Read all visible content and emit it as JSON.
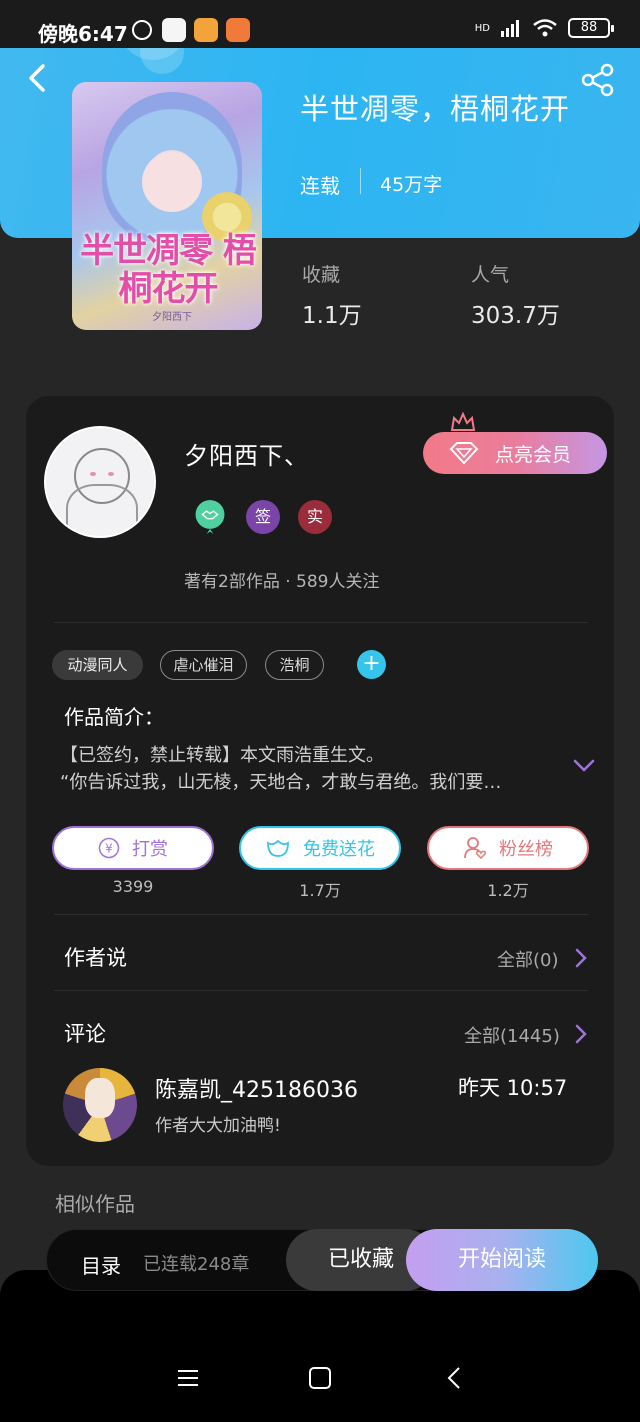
{
  "status_bar": {
    "time": "傍晚6:47",
    "network": "HD",
    "battery": "88"
  },
  "book": {
    "title": "半世凋零，梧桐花开",
    "status": "连载",
    "word_count": "45万字",
    "cover_title": "半世凋零 梧桐花开",
    "cover_author": "夕阳西下"
  },
  "stats": {
    "favorites_label": "收藏",
    "favorites_value": "1.1万",
    "popularity_label": "人气",
    "popularity_value": "303.7万"
  },
  "author": {
    "name": "夕阳西下、",
    "badges": [
      "签",
      "实"
    ],
    "meta": "著有2部作品 · 589人关注",
    "vip_button": "点亮会员"
  },
  "tags": [
    "动漫同人",
    "虐心催泪",
    "浩桐"
  ],
  "intro": {
    "title": "作品简介：",
    "line1": "【已签约，禁止转载】本文雨浩重生文。",
    "line2": "“你告诉过我，山无棱，天地合，才敢与君绝。我们要…"
  },
  "actions": [
    {
      "label": "打赏",
      "count": "3399"
    },
    {
      "label": "免费送花",
      "count": "1.7万"
    },
    {
      "label": "粉丝榜",
      "count": "1.2万"
    }
  ],
  "author_says": {
    "title": "作者说",
    "link": "全部(0)"
  },
  "comments": {
    "title": "评论",
    "link": "全部(1445)",
    "items": [
      {
        "user": "陈嘉凯_425186036",
        "time": "昨天 10:57",
        "text": "作者大大加油鸭!"
      }
    ]
  },
  "similar_title": "相似作品",
  "bottom_bar": {
    "toc": "目录",
    "chapters": "已连载248章",
    "collected": "已收藏",
    "read": "开始阅读"
  },
  "colors": {
    "header": "#2cb5f2",
    "accent_cyan": "#35c4ea",
    "vip_start": "#f27a88",
    "vip_end": "#c596e4",
    "reward_purple": "#a073dc",
    "flower_cyan": "#35c4ea",
    "fans_red": "#e4787a"
  }
}
